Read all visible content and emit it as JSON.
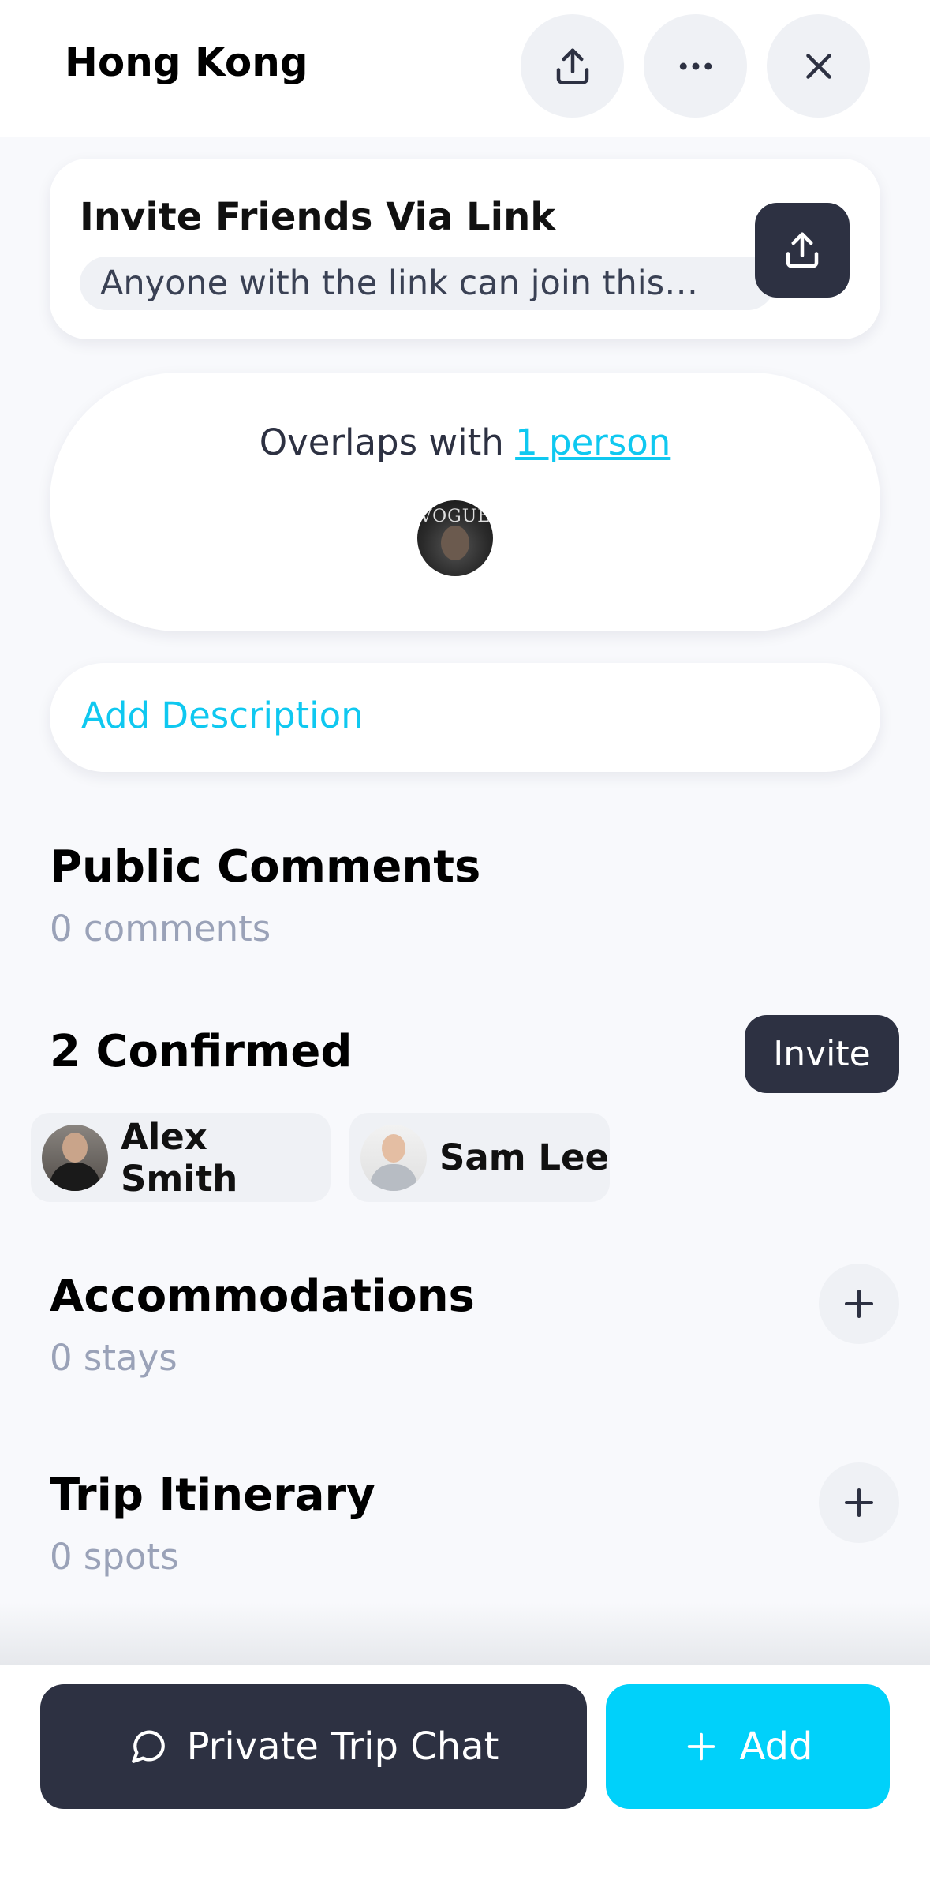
{
  "header": {
    "title": "Hong Kong",
    "icons": [
      "share-icon",
      "more-icon",
      "close-icon"
    ]
  },
  "invite": {
    "title": "Invite Friends Via Link",
    "subtitle": "Anyone with the link can join this…"
  },
  "overlap": {
    "prefix": "Overlaps with ",
    "link": "1 person",
    "avatar_text": "VOGUE"
  },
  "description": {
    "label": "Add Description"
  },
  "comments": {
    "title": "Public Comments",
    "count": "0 comments"
  },
  "confirmed": {
    "title": "2 Confirmed",
    "invite_label": "Invite",
    "people": [
      {
        "name": "Alex Smith"
      },
      {
        "name": "Sam Lee"
      }
    ]
  },
  "accommodations": {
    "title": "Accommodations",
    "count": "0 stays"
  },
  "itinerary": {
    "title": "Trip Itinerary",
    "count": "0 spots"
  },
  "bottom": {
    "chat_label": "Private Trip Chat",
    "add_label": "Add"
  },
  "colors": {
    "accent": "#00d1fa",
    "dark": "#2d3142",
    "muted": "#9aa2b8",
    "background": "#f8f9fc"
  }
}
